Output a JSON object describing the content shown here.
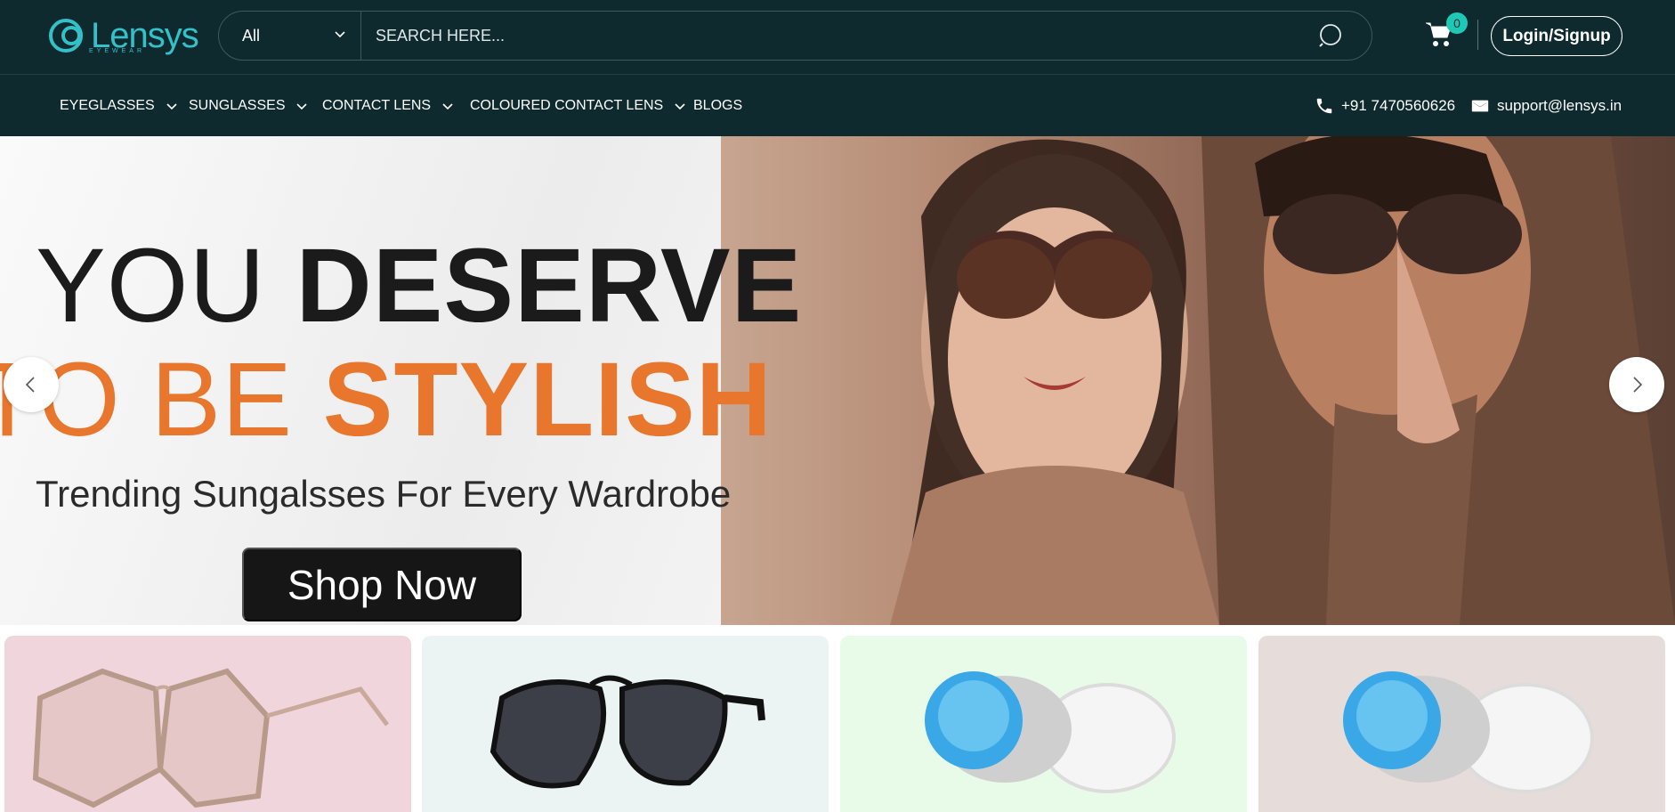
{
  "brand": {
    "name": "Lensys",
    "tagline": "EYEWEAR",
    "accent": "#34c0c8",
    "dark": "#0f2a2e"
  },
  "search": {
    "category": "All",
    "placeholder": "SEARCH HERE..."
  },
  "cart": {
    "count": "0"
  },
  "header": {
    "login_label": "Login/Signup"
  },
  "nav": {
    "items": [
      {
        "label": "EYEGLASSES",
        "icon": "chevron-down-icon"
      },
      {
        "label": "SUNGLASSES",
        "icon": "chevron-down-icon"
      },
      {
        "label": "CONTACT LENS",
        "icon": "chevron-down-icon"
      },
      {
        "label": "COLOURED CONTACT LENS",
        "icon": "chevron-down-icon"
      },
      {
        "label": "BLOGS"
      }
    ],
    "phone": "+91 7470560626",
    "email": "support@lensys.in"
  },
  "hero": {
    "line1_light": "YOU",
    "line1_bold": "DESERVE",
    "line2_light": "TO BE",
    "line2_bold": "STYLISH",
    "subtitle": "Trending Sungalsses For Every Wardrobe",
    "cta": "Shop Now",
    "accent": "#e8762d"
  },
  "categories": [
    {
      "name": "eyeglasses",
      "bg": "#f0d5dc"
    },
    {
      "name": "sunglasses",
      "bg": "#ecf4f3"
    },
    {
      "name": "contact-lens",
      "bg": "#e8fbe9"
    },
    {
      "name": "coloured-contact-lens",
      "bg": "#e6ddda"
    }
  ]
}
